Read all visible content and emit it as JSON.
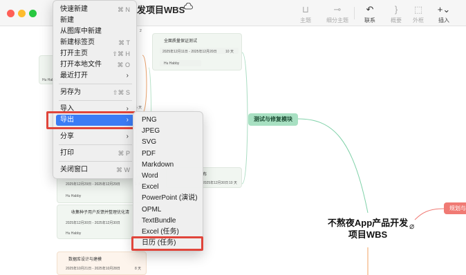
{
  "titlebar": {
    "doc_title": "不熬夜App产品开发项目WBS",
    "visible_title": "发项目WBS",
    "chevron": "⌄"
  },
  "toolbar": [
    {
      "label": "主题",
      "icon": "topic-icon",
      "glyph": "⊔",
      "dim": true
    },
    {
      "label": "细分主题",
      "icon": "subtopic-icon",
      "glyph": "⊸",
      "dim": true
    },
    {
      "label": "联系",
      "icon": "relationship-icon",
      "glyph": "↶",
      "dim": false
    },
    {
      "label": "概要",
      "icon": "summary-icon",
      "glyph": "}",
      "dim": true
    },
    {
      "label": "外框",
      "icon": "boundary-icon",
      "glyph": "⬚",
      "dim": true
    },
    {
      "label": "插入",
      "icon": "insert-icon",
      "glyph": "+⌄",
      "dim": false
    }
  ],
  "mainMenu": [
    {
      "label": "快速新建",
      "shortcut": "⌘ N"
    },
    {
      "label": "新建",
      "shortcut": ""
    },
    {
      "label": "从图库中新建",
      "shortcut": ""
    },
    {
      "label": "新建标签页",
      "shortcut": "⌘ T"
    },
    {
      "label": "打开主页",
      "shortcut": "⇧⌘ H"
    },
    {
      "label": "打开本地文件",
      "shortcut": "⌘ O"
    },
    {
      "label": "最近打开",
      "shortcut": "›"
    },
    {
      "label": "另存为",
      "shortcut": "⇧⌘ S"
    },
    {
      "label": "导入",
      "shortcut": "›"
    },
    {
      "label": "导出",
      "shortcut": "›"
    },
    {
      "label": "分享",
      "shortcut": "›"
    },
    {
      "label": "打印",
      "shortcut": "⌘ P"
    },
    {
      "label": "关闭窗口",
      "shortcut": "⌘ W"
    }
  ],
  "exportMenu": [
    "PNG",
    "JPEG",
    "SVG",
    "PDF",
    "Markdown",
    "Word",
    "Excel",
    "PowerPoint (演说)",
    "OPML",
    "TextBundle",
    "Excel (任务)",
    "日历 (任务)"
  ],
  "mindmap": {
    "branch": "测试与修复模块",
    "root_line1": "不熬夜App产品开发",
    "root_line2": "项目WBS",
    "right_node": "规划与",
    "card_top_title": "全面质量保证测试",
    "card_top_date": "2025年12月11日 - 2025年12月20日",
    "card_top_days": "10 天",
    "card_top_owner": "Hu Habby",
    "card_mid_title": "布",
    "card_mid_date": "2025年12月29日 - 2025年12月29日",
    "card_mid_days": "1 天",
    "card_mid_owner": "Hu Habby",
    "card_mid2_date": "2025年12月30日",
    "card_mid2_days": "10 天",
    "card_feedback_title": "收集种子用户反馈并整理优化清",
    "card_feedback_date": "2025年12月30日 - 2025年12月30日",
    "card_feedback_days": "1 天",
    "card_feedback_owner": "Hu Habby",
    "card_db_title": "数据库设计与建模",
    "card_db_date": "2025年10月21日 - 2025年10月28日",
    "card_db_days": "8 天",
    "left_owner": "Hu Habby",
    "left_stub_1": "2",
    "left_stub_2": "5 天",
    "left_stub_3": "5 天"
  }
}
